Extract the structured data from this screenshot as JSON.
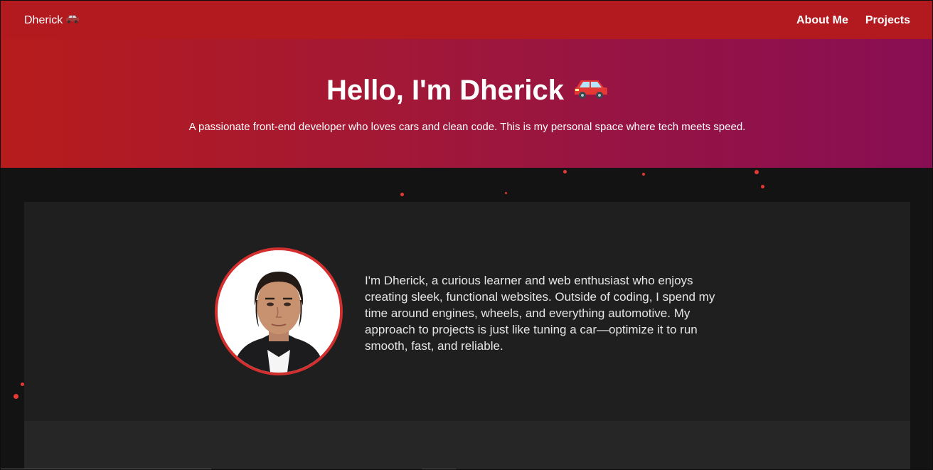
{
  "nav": {
    "brand": "Dherick",
    "brand_icon": "car-icon",
    "links": [
      {
        "label": "About Me"
      },
      {
        "label": "Projects"
      }
    ]
  },
  "hero": {
    "title": "Hello, I'm Dherick",
    "title_icon": "car-icon",
    "subtitle": "A passionate front-end developer who loves cars and clean code. This is my personal space where tech meets speed."
  },
  "about": {
    "text": "I'm Dherick, a curious learner and web enthusiast who enjoys creating sleek, functional websites. Outside of coding, I spend my time around engines, wheels, and everything automotive. My approach to projects is just like tuning a car—optimize it to run smooth, fast, and reliable."
  },
  "colors": {
    "navbar": "#b31a1f",
    "hero_start": "#b71c1c",
    "hero_end": "#880e54",
    "accent": "#d32f2f",
    "background": "#131313",
    "card": "#1f1f1f"
  }
}
